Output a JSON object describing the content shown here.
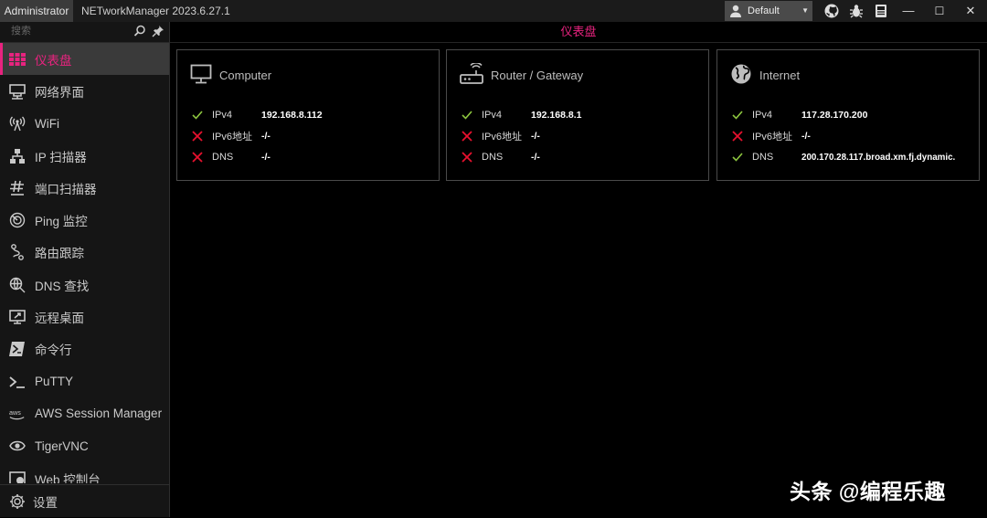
{
  "titlebar": {
    "admin_label": "Administrator",
    "app_title": "NETworkManager 2023.6.27.1",
    "profile": "Default",
    "minimize": "—",
    "maximize": "☐",
    "close": "✕"
  },
  "sidebar": {
    "search_placeholder": "搜索",
    "items": [
      {
        "label": "仪表盘",
        "icon": "dashboard-icon"
      },
      {
        "label": "网络界面",
        "icon": "network-interface-icon"
      },
      {
        "label": "WiFi",
        "icon": "wifi-icon"
      },
      {
        "label": "IP 扫描器",
        "icon": "ip-scanner-icon"
      },
      {
        "label": "端口扫描器",
        "icon": "port-scanner-icon"
      },
      {
        "label": "Ping 监控",
        "icon": "ping-monitor-icon"
      },
      {
        "label": "路由跟踪",
        "icon": "traceroute-icon"
      },
      {
        "label": "DNS 查找",
        "icon": "dns-lookup-icon"
      },
      {
        "label": "远程桌面",
        "icon": "remote-desktop-icon"
      },
      {
        "label": "命令行",
        "icon": "powershell-icon"
      },
      {
        "label": "PuTTY",
        "icon": "terminal-icon"
      },
      {
        "label": "AWS Session Manager",
        "icon": "aws-icon"
      },
      {
        "label": "TigerVNC",
        "icon": "eye-icon"
      },
      {
        "label": "Web 控制台",
        "icon": "web-console-icon"
      }
    ],
    "settings_label": "设置"
  },
  "main": {
    "page_title": "仪表盘",
    "cards": [
      {
        "title": "Computer",
        "rows": [
          {
            "status": "ok",
            "key": "IPv4",
            "value": "192.168.8.112"
          },
          {
            "status": "fail",
            "key": "IPv6地址",
            "value": "-/-"
          },
          {
            "status": "fail",
            "key": "DNS",
            "value": "-/-"
          }
        ]
      },
      {
        "title": "Router / Gateway",
        "rows": [
          {
            "status": "ok",
            "key": "IPv4",
            "value": "192.168.8.1"
          },
          {
            "status": "fail",
            "key": "IPv6地址",
            "value": "-/-"
          },
          {
            "status": "fail",
            "key": "DNS",
            "value": "-/-"
          }
        ]
      },
      {
        "title": "Internet",
        "rows": [
          {
            "status": "ok",
            "key": "IPv4",
            "value": "117.28.170.200"
          },
          {
            "status": "fail",
            "key": "IPv6地址",
            "value": "-/-"
          },
          {
            "status": "ok",
            "key": "DNS",
            "value": "200.170.28.117.broad.xm.fj.dynamic."
          }
        ]
      }
    ]
  },
  "watermark": "头条 @编程乐趣",
  "colors": {
    "accent": "#e8237f",
    "ok": "#8dc63f",
    "fail": "#e8102e"
  }
}
